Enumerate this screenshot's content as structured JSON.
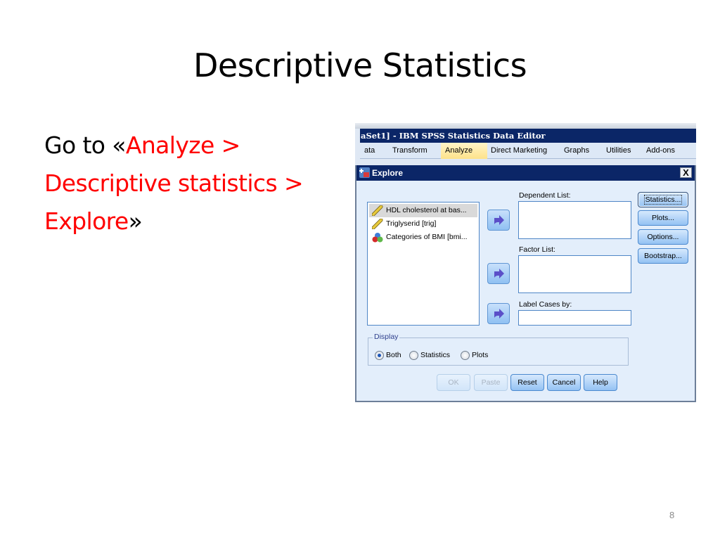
{
  "slide": {
    "title": "Descriptive Statistics",
    "instruction": {
      "prefix": "Go to «",
      "path_line1": "Analyze >",
      "path_line2": "Descriptive statistics >",
      "path_line3": "Explore",
      "suffix": "»"
    },
    "page_number": "8",
    "accent_color": "#ff0000"
  },
  "spss": {
    "app_title": "aSet1] - IBM SPSS Statistics Data Editor",
    "menu": [
      {
        "label": "ata"
      },
      {
        "label": "Transform"
      },
      {
        "label": "Analyze",
        "active": true
      },
      {
        "label": "Direct Marketing"
      },
      {
        "label": "Graphs"
      },
      {
        "label": "Utilities"
      },
      {
        "label": "Add-ons"
      }
    ],
    "dialog": {
      "title": "Explore",
      "close_label": "X",
      "variables": [
        {
          "label": "HDL cholesterol at bas...",
          "icon": "scale-ruler-icon",
          "selected": true
        },
        {
          "label": "Triglyserid  [trig]",
          "icon": "scale-ruler-icon"
        },
        {
          "label": "Categories of BMI [bmi...",
          "icon": "nominal-balls-icon"
        }
      ],
      "dependent_list_label": "Dependent List:",
      "factor_list_label": "Factor List:",
      "label_cases_label": "Label Cases by:",
      "side_buttons": [
        "Statistics...",
        "Plots...",
        "Options...",
        "Bootstrap..."
      ],
      "display": {
        "legend": "Display",
        "options": [
          "Both",
          "Statistics",
          "Plots"
        ],
        "selected": "Both"
      },
      "buttons": {
        "ok": "OK",
        "paste": "Paste",
        "reset": "Reset",
        "cancel": "Cancel",
        "help": "Help"
      }
    }
  }
}
